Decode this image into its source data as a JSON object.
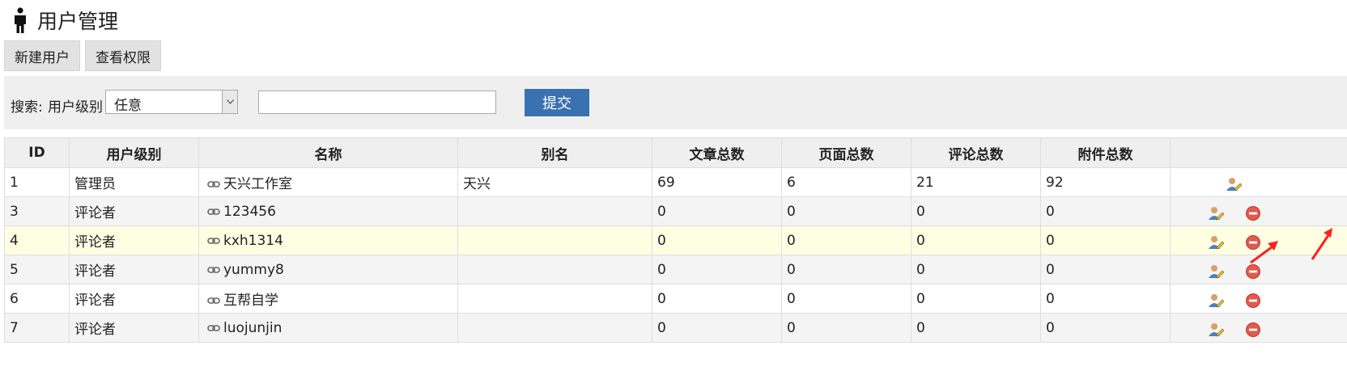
{
  "header": {
    "title": "用户管理",
    "icon": "person-icon"
  },
  "toolbar": {
    "new_user": "新建用户",
    "view_permissions": "查看权限"
  },
  "search": {
    "label": "搜索:",
    "level_label": "用户级别",
    "level_value": "任意",
    "keyword_value": "",
    "submit": "提交"
  },
  "table": {
    "headers": [
      "ID",
      "用户级别",
      "名称",
      "别名",
      "文章总数",
      "页面总数",
      "评论总数",
      "附件总数",
      ""
    ],
    "rows": [
      {
        "id": "1",
        "level": "管理员",
        "name": "天兴工作室",
        "alias": "天兴",
        "articles": "69",
        "pages": "6",
        "comments": "21",
        "attachments": "92"
      },
      {
        "id": "3",
        "level": "评论者",
        "name": "123456",
        "alias": "",
        "articles": "0",
        "pages": "0",
        "comments": "0",
        "attachments": "0"
      },
      {
        "id": "4",
        "level": "评论者",
        "name": "kxh1314",
        "alias": "",
        "articles": "0",
        "pages": "0",
        "comments": "0",
        "attachments": "0"
      },
      {
        "id": "5",
        "level": "评论者",
        "name": "yummy8",
        "alias": "",
        "articles": "0",
        "pages": "0",
        "comments": "0",
        "attachments": "0"
      },
      {
        "id": "6",
        "level": "评论者",
        "name": "互帮自学",
        "alias": "",
        "articles": "0",
        "pages": "0",
        "comments": "0",
        "attachments": "0"
      },
      {
        "id": "7",
        "level": "评论者",
        "name": "luojunjin",
        "alias": "",
        "articles": "0",
        "pages": "0",
        "comments": "0",
        "attachments": "0"
      }
    ]
  },
  "colors": {
    "submit_bg": "#3a71b1",
    "highlight_row": "#fefee2",
    "delete_icon": "#e05a4e",
    "annotation_arrow": "#ff2020"
  }
}
